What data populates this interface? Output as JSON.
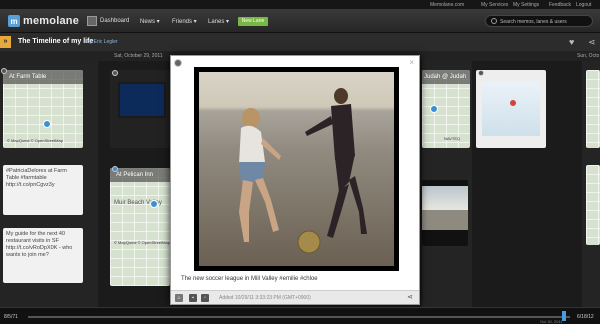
{
  "util": {
    "links": [
      "Memolane.com",
      "My Services",
      "My Settings",
      "Feedback",
      "Logout"
    ]
  },
  "nav": {
    "logo": "memolane",
    "dashboard": "Dashboard",
    "news": "News ▾",
    "friends": "Friends ▾",
    "lanes": "Lanes ▾",
    "new_lane": "New Lane",
    "search_placeholder": "Search memos, lanes & users"
  },
  "timeline": {
    "title": "The Timeline of my life",
    "by": "by Eric Legler",
    "dates": [
      "Sat, October 29, 2011",
      "Sun, Octo"
    ]
  },
  "cards": {
    "c1_title": "At Farm Table",
    "c2_text": "#PatriciaDelores at Farm Table #farmtable http://t.co/pnCgvz3y",
    "c3_text": "My guide for the next 40 restaurant visits in SF http://t.co/vRoDpX0K - who wants to join me?",
    "c4_title": "At Pelican Inn",
    "c4_map": "Muir Beach Valley",
    "c5_title": "Judah @ Judah",
    "map_credit": "© MapQuest © OpenStreetMap",
    "navteq": "NAVTEQ"
  },
  "modal": {
    "caption": "The new soccer league in Mill Valley #emilie #chloe",
    "added": "Added 10/29/11 3:33:23 PM (GMT+0900)",
    "close": "×"
  },
  "bottom": {
    "left": "8/5/71",
    "right": "6/18/12",
    "sub": "Oct 30, 2011"
  },
  "progress": 0.96
}
